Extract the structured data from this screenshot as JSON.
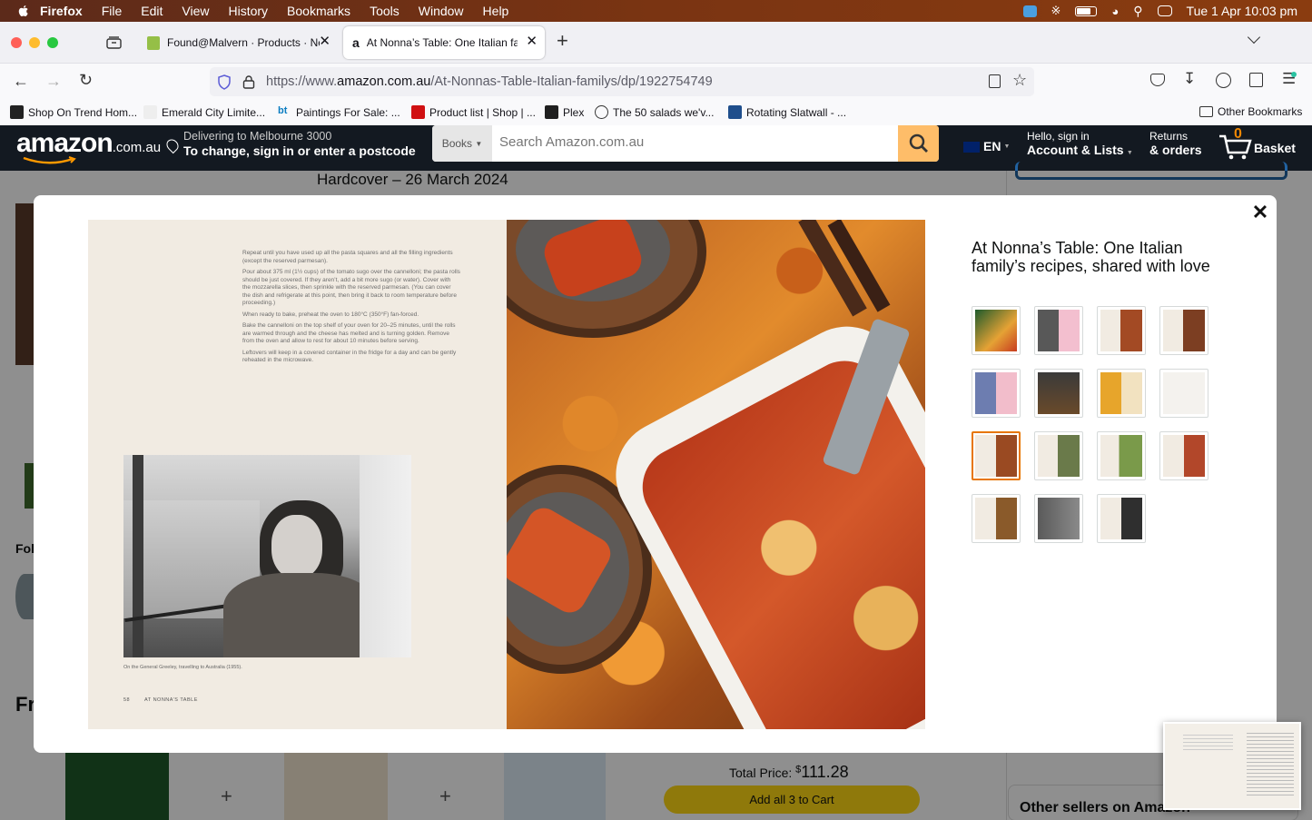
{
  "menubar": {
    "app": "Firefox",
    "items": [
      "File",
      "Edit",
      "View",
      "History",
      "Bookmarks",
      "Tools",
      "Window",
      "Help"
    ],
    "clock": "Tue 1 Apr  10:03 pm"
  },
  "tabs": [
    {
      "title": "Found@Malvern · Products · Ne"
    },
    {
      "title": "At Nonna’s Table: One Italian fa"
    }
  ],
  "url": {
    "prefix": "https://www.",
    "domain": "amazon.com.au",
    "path": "/At-Nonnas-Table-Italian-familys/dp/1922754749"
  },
  "bookmarks": [
    "Shop On Trend Hom...",
    "Emerald City Limite...",
    "Paintings For Sale: ...",
    "Product list | Shop | ...",
    "Plex",
    "The 50 salads we'v...",
    "Rotating Slatwall - ...",
    "Other Bookmarks"
  ],
  "amazon": {
    "logo": "amazon",
    "logo_suffix": ".com.au",
    "deliver_line1": "Delivering to Melbourne 3000",
    "deliver_line2": "To change, sign in or enter a postcode",
    "search_category": "Books",
    "search_placeholder": "Search Amazon.com.au",
    "lang": "EN",
    "account_line1": "Hello, sign in",
    "account_line2": "Account & Lists",
    "returns_line1": "Returns",
    "returns_line2": "& orders",
    "basket_count": "0",
    "basket_label": "Basket"
  },
  "page": {
    "format": "Hardcover – 26 March 2024",
    "total_label": "Total Price:",
    "total_currency": "$",
    "total_value": "111.28",
    "add_all": "Add all 3 to Cart",
    "other_sellers": "Other sellers on Amazon",
    "fol": "Fol",
    "fr": "Fr"
  },
  "modal": {
    "title": "At Nonna’s Table: One Italian family’s recipes, shared with love",
    "left_page_paragraphs": [
      "Repeat until you have used up all the pasta squares and all the filling ingredients (except the reserved parmesan).",
      "Pour about 375 ml (1½ cups) of the tomato sugo over the cannelloni; the pasta rolls should be just covered. If they aren’t, add a bit more sugo (or water). Cover with the mozzarella slices, then sprinkle with the reserved parmesan. (You can cover the dish and refrigerate at this point, then bring it back to room temperature before proceeding.)",
      "When ready to bake, preheat the oven to 180°C (350°F) fan-forced.",
      "Bake the cannelloni on the top shelf of your oven for 20–25 minutes, until the rolls are warmed through and the cheese has melted and is turning golden. Remove from the oven and allow to rest for about 10 minutes before serving.",
      "Leftovers will keep in a covered container in the fridge for a day and can be gently reheated in the microwave."
    ],
    "photo_caption": "On the General Greeley, travelling to Australia (1955).",
    "folio": "58        AT NONNA’S TABLE",
    "thumbnail_count": 15,
    "selected_thumbnail": 9,
    "colors": {
      "selected_border": "#e77600",
      "cart_button": "#ffd814",
      "amazon_nav": "#131921"
    }
  }
}
